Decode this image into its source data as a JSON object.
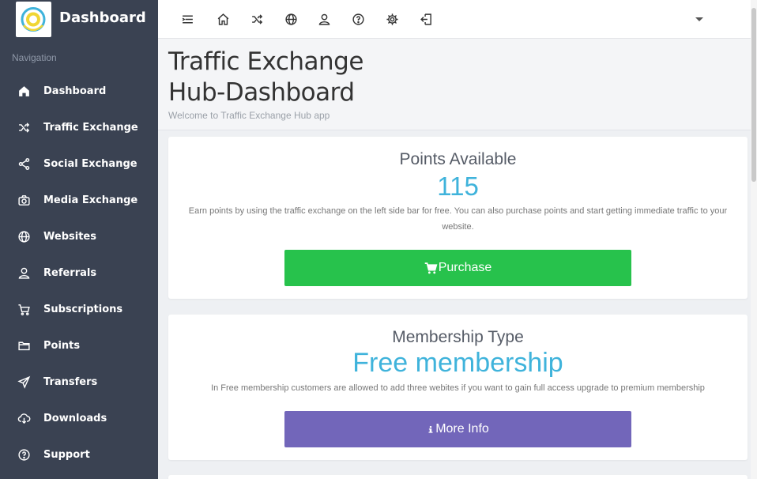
{
  "app": {
    "brand_title": "Dashboard"
  },
  "sidebar": {
    "heading": "Navigation",
    "items": [
      {
        "label": "Dashboard",
        "icon": "home-icon"
      },
      {
        "label": "Traffic Exchange",
        "icon": "shuffle-icon"
      },
      {
        "label": "Social Exchange",
        "icon": "share-icon"
      },
      {
        "label": "Media Exchange",
        "icon": "camera-icon"
      },
      {
        "label": "Websites",
        "icon": "globe-icon"
      },
      {
        "label": "Referrals",
        "icon": "user-icon"
      },
      {
        "label": "Subscriptions",
        "icon": "cart-icon"
      },
      {
        "label": "Points",
        "icon": "folder-icon"
      },
      {
        "label": "Transfers",
        "icon": "paper-plane-icon"
      },
      {
        "label": "Downloads",
        "icon": "cloud-download-icon"
      },
      {
        "label": "Support",
        "icon": "help-icon"
      }
    ]
  },
  "topbar": {
    "icons": [
      "menu-toggle-icon",
      "home-icon",
      "shuffle-icon",
      "globe-icon",
      "user-icon",
      "help-icon",
      "gear-icon",
      "logout-icon"
    ]
  },
  "page": {
    "title": "Traffic Exchange Hub-Dashboard",
    "subtitle": "Welcome to Traffic Exchange Hub app"
  },
  "points_card": {
    "title": "Points Available",
    "value": "115",
    "description": "Earn points by using the traffic exchange on the left side bar for free. You can also purchase points and start getting immediate traffic to your website.",
    "button_label": "Purchase"
  },
  "membership_card": {
    "title": "Membership Type",
    "value": "Free membership",
    "description": "In Free membership customers are allowed to add three webites if you want to gain full access upgrade to premium membership",
    "button_label": "More Info"
  },
  "colors": {
    "sidebar_bg": "#3a4252",
    "accent_blue": "#3fb3db",
    "button_green": "#27c24c",
    "button_purple": "#7266ba"
  }
}
